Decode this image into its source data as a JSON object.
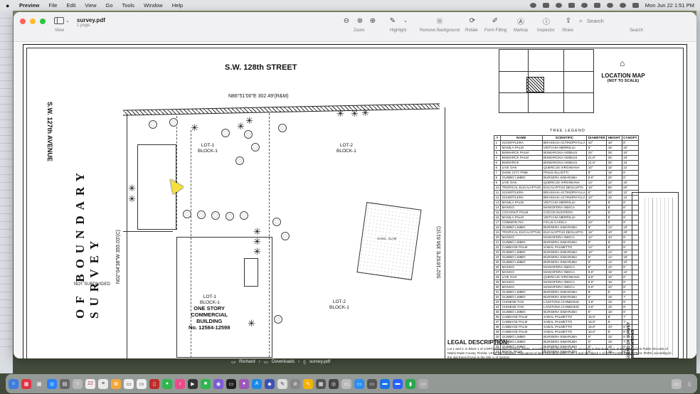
{
  "menubar": {
    "app": "Preview",
    "items": [
      "File",
      "Edit",
      "View",
      "Go",
      "Tools",
      "Window",
      "Help"
    ],
    "datetime": "Mon Jun 22  1:51 PM"
  },
  "window": {
    "title": "survey.pdf",
    "subtitle": "1 page",
    "view_label": "View",
    "toolbar": {
      "zoom": "Zoom",
      "highlight": "Highlight",
      "remove_background": "Remove Background",
      "rotate": "Rotate",
      "form_filling": "Form Filling",
      "markup": "Markup",
      "inspector": "Inspector",
      "share": "Share",
      "search_label": "Search",
      "search_placeholder": "Search"
    }
  },
  "document": {
    "vertical_title": "OF BOUNDARY SURVEY",
    "street": "S.W. 128th STREET",
    "avenue": "S.W. 127th AVENUE",
    "bearing_top": "N86°51'00\"E 302.49'(R&M)",
    "bearing_left": "N02°04'38\"W 355.03'(C)",
    "bearing_right": "S02°16'02\"E 356.61'(C)",
    "not_subdivided": "NOT SUBDIVIDED",
    "lots": [
      {
        "line1": "LOT-1",
        "line2": "BLOCK-1"
      },
      {
        "line1": "LOT-2",
        "line2": "BLOCK-1"
      },
      {
        "line1": "LOT-1",
        "line2": "BLOCK-1"
      },
      {
        "line1": "LOT-2",
        "line2": "BLOCK-1"
      }
    ],
    "building": [
      "ONE STORY",
      "COMMERCIAL",
      "BUILDING",
      "No. 12584-12598"
    ],
    "slab": "CONC. SLAB",
    "location_map": {
      "title": "LOCATION MAP",
      "subtitle": "(NOT TO SCALE)"
    },
    "tree_legend": {
      "title": "TREE LEGEND",
      "headers": [
        "#",
        "NAME",
        "SCIENTIFIC",
        "DIAMETER",
        "HEIGHT",
        "CANOPY"
      ],
      "rows": [
        [
          "1",
          "SCHEFFLERA",
          "BRASSAIA ACTINOPHYLLA",
          "10\"",
          "18'",
          "8'"
        ],
        [
          "2",
          "MANILA PALM",
          "VEITCHIA MERRILLII",
          "5\"",
          "15'",
          "10'"
        ],
        [
          "3",
          "BISMARCK PALM",
          "BISMARCKIA NOBILIS",
          "24\"",
          "25'",
          "15'"
        ],
        [
          "4",
          "BISMARCK PALM",
          "BISMARCKIA NOBILIS",
          "21.6\"",
          "25'",
          "15'"
        ],
        [
          "5",
          "BISMARCK",
          "BISMARCKIA NOBILIS",
          "21.6\"",
          "25'",
          "15'"
        ],
        [
          "6",
          "LIVE OAK",
          "QUERCUS VIRGINIANA",
          "10\"",
          "15'",
          "12'"
        ],
        [
          "7",
          "DADE CITY PINE",
          "PINUS ELLIOTTI",
          "8\"",
          "18'",
          "8'"
        ],
        [
          "8",
          "GUMBO LIMBO",
          "BURSERA SIMARUBA",
          "9.6\"",
          "20'",
          "8'"
        ],
        [
          "9",
          "LIVE OAK",
          "QUERCUS VIRGINIANA",
          "14\"",
          "12'",
          "15'"
        ],
        [
          "10",
          "TROPICAL EUCALYPTUS",
          "EUCALYPTUS DEGLUPTA",
          "18\"",
          "50'",
          "20'"
        ],
        [
          "11",
          "SCHEFFLERA",
          "BRASSAIA ACTINOPHYLLA",
          "6\"",
          "20'",
          "12'"
        ],
        [
          "12",
          "SCHEFFLERA",
          "BRASSAIA ACTINOPHYLLA",
          "10\"",
          "15'",
          "12'"
        ],
        [
          "13",
          "MANILA PALM",
          "VEITCHIA MERRILLII",
          "5\"",
          "8'",
          "8'"
        ],
        [
          "14",
          "MANGO",
          "MANGIFERA INDICA",
          "8\"",
          "8'",
          "8'"
        ],
        [
          "15",
          "COCONUT PALM",
          "COCOS NUCIFERA",
          "8\"",
          "8'",
          "8'"
        ],
        [
          "16",
          "MANILA PALM",
          "VEITCHIA MERRILLII",
          "5\"",
          "8'",
          "8'"
        ],
        [
          "17",
          "COMMON FIG",
          "FICUS CARICA",
          "10\"",
          "8'",
          "8'"
        ],
        [
          "18",
          "GUMBO LIMBO",
          "BURSERA SIMARUBA",
          "8\"",
          "13'",
          "10'"
        ],
        [
          "19",
          "TROPICAL EUCALYPTUS",
          "EUCALYPTUS DEGLUPTA",
          "18\"",
          "40'",
          "20'"
        ],
        [
          "20",
          "MANGO",
          "MANGIFERA INDICA",
          "12\"",
          "10'",
          "8'"
        ],
        [
          "21",
          "GUMBO LIMBO",
          "BURSERA SIMARUBA",
          "8\"",
          "8'",
          "8'"
        ],
        [
          "22",
          "CABBAGE PALM",
          "SABAL PALMETTO",
          "14\"",
          "8'",
          "8'"
        ],
        [
          "23",
          "GUMBO LIMBO",
          "BURSERA SIMARUBA",
          "10\"",
          "12'",
          "10'"
        ],
        [
          "24",
          "GUMBO LIMBO",
          "BURSERA SIMARUBA",
          "8\"",
          "12'",
          "15'"
        ],
        [
          "25",
          "GUMBO LIMBO",
          "BURSERA SIMARUBA",
          "6\"",
          "12'",
          "10'"
        ],
        [
          "26",
          "MANGO",
          "MANGIFERA INDICA",
          "8\"",
          "10'",
          "8'"
        ],
        [
          "27",
          "MANGO",
          "MANGIFERA INDICA",
          "9.6\"",
          "15'",
          "12'"
        ],
        [
          "28",
          "LIVE OAK",
          "QUERCUS VIRGINIANA",
          "9.6\"",
          "18'",
          "8'"
        ],
        [
          "29",
          "MANGO",
          "MANGIFERA INDICA",
          "9.6\"",
          "15'",
          "8'"
        ],
        [
          "30",
          "MANGO",
          "MANGIFERA INDICA",
          "9.6\"",
          "10'",
          "8'"
        ],
        [
          "31",
          "GUMBO LIMBO",
          "BURSERA SIMARUBA",
          "6\"",
          "8'",
          "8'"
        ],
        [
          "32",
          "GUMBO LIMBO",
          "BURSERA SIMARUBA",
          "6\"",
          "16'",
          "7'"
        ],
        [
          "33",
          "CHINESE FAN",
          "LIVISTONA CHINENSIS",
          "4.8\"",
          "15'",
          "8'"
        ],
        [
          "34",
          "CHINESE FAN",
          "LIVISTONA CHINENSIS",
          "4.8\"",
          "15'",
          "8'"
        ],
        [
          "35",
          "GUMBO LIMBO",
          "BURSERA SIMARUBA",
          "6\"",
          "16'",
          "8'"
        ],
        [
          "36",
          "CABBAGE PALM",
          "SABAL PALMETTO",
          "15.6\"",
          "8'",
          "7'"
        ],
        [
          "37",
          "CABBAGE PALM",
          "SABAL PALMETTO",
          "15.6\"",
          "5'",
          "7'"
        ],
        [
          "38",
          "CABBAGE PALM",
          "SABAL PALMETTO",
          "15.6\"",
          "10'",
          "8'"
        ],
        [
          "39",
          "CABBAGE PALM",
          "SABAL PALMETTO",
          "15.6\"",
          "8'",
          "8'"
        ],
        [
          "40",
          "GUMBO LIMBO",
          "BURSERA SIMARUBA",
          "6\"",
          "16'",
          "8'"
        ],
        [
          "41",
          "GUMBO LIMBO",
          "BURSERA SIMARUBA",
          "6\"",
          "16'",
          "7'"
        ],
        [
          "42",
          "GUMBO LIMBO",
          "BURSERA SIMARUBA",
          "6\"",
          "16'",
          "8'"
        ],
        [
          "43",
          "ROYAL PALM",
          "BURSERA SIMARUBA",
          "6\"",
          "16'",
          "8'"
        ]
      ]
    },
    "abbrev_title": "LEGEND OF SURVEY ABBREVIATIONS",
    "legal": {
      "title": "LEGAL DESCRIPTION:",
      "text": "Lot 1 and 2, in Block 1 of CORTLAND INDUSTRIAL PARK, according to the Plat thereof, as recorded in Plat Book 113, at Page 52, of the Public Records of Miami Dade County, Florida. LESS the following: That parcel of land extending within Lots 1 and 2 in Block 1 of CORTLAND INDUSTRIAL PARK, according to the plat thereof lying in the SW ¼ of Section"
    }
  },
  "pathbar": [
    "Richard",
    "Downloads",
    "survey.pdf"
  ]
}
